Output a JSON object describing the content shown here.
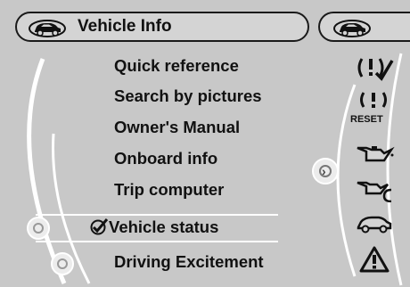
{
  "header": {
    "title": "Vehicle Info",
    "car_icon": "car-outline-icon"
  },
  "side_panel": {
    "car_icon": "car-outline-icon"
  },
  "menu": {
    "items": [
      {
        "label": "Quick reference"
      },
      {
        "label": "Search by pictures"
      },
      {
        "label": "Owner's Manual"
      },
      {
        "label": "Onboard info"
      },
      {
        "label": "Trip computer"
      },
      {
        "label": "Vehicle status",
        "selected": true,
        "check_icon": "checkmark-icon"
      },
      {
        "label": "Driving Excitement"
      }
    ]
  },
  "icons": {
    "quick_reference": "warning-check-icon",
    "reset": {
      "icon": "tire-warning-icon",
      "label": "RESET"
    },
    "oil_can": "oil-can-icon",
    "oil_level": "oil-level-icon",
    "car": "car-icon",
    "warning": "warning-triangle-icon"
  },
  "colors": {
    "background": "#c8c8c8",
    "text": "#111111",
    "selection_line": "#ffffff"
  }
}
